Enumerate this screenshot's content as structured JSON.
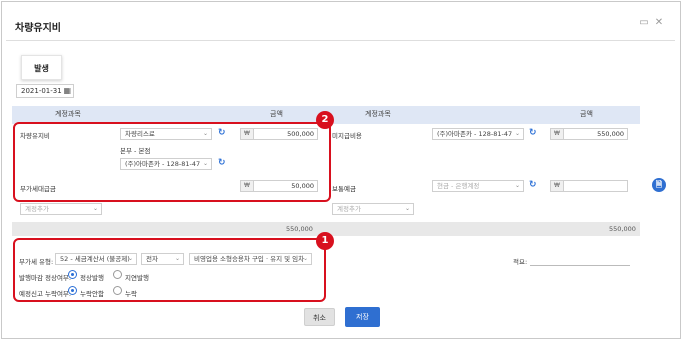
{
  "window": {
    "title": "차량유지비"
  },
  "tabs": [
    {
      "label": "발생"
    }
  ],
  "date": {
    "value": "2021-01-31"
  },
  "table_header": {
    "col1": "계정과목",
    "col2": "금액",
    "col3": "계정과목",
    "col4": "금액"
  },
  "left": {
    "row1_label": "차량유지비",
    "row1_select": "차량리스료",
    "row1_amount_currency": "₩",
    "row1_amount": "500,000",
    "branch_label": "본부 - 본점",
    "vendor_select": "(주)아마존카 - 128-81-47",
    "row2_label": "부가세대급금",
    "row2_amount_currency": "₩",
    "row2_amount": "50,000",
    "add_account_placeholder": "계정추가",
    "total": "550,000"
  },
  "right": {
    "row1_label": "미지급비용",
    "vendor_select": "(주)아마존카 - 128-81-47",
    "row1_amount_currency": "₩",
    "row1_amount": "550,000",
    "row2_label": "보통예금",
    "bank_placeholder": "현금 - 은행계정",
    "row2_amount_currency": "₩",
    "row2_amount": "",
    "add_account_placeholder": "계정추가",
    "total": "550,000"
  },
  "vat": {
    "type_label": "부가세 유형:",
    "type_select": "52 - 세금계산서 (불공제)",
    "issue_select": "전자",
    "reason_select": "비영업용 소형승용차 구입 · 유지 및 임차",
    "issue_normal_label": "발행마감 정상여부:",
    "issue_normal_on": "정상발행",
    "issue_normal_off": "지연발행",
    "report_label": "예정신고 누락여부:",
    "report_on": "누락안함",
    "report_off": "누락",
    "memo_label": "적요:",
    "memo_value": ""
  },
  "buttons": {
    "cancel": "취소",
    "save": "저장"
  },
  "badges": {
    "one": "1",
    "two": "2"
  },
  "colors": {
    "accent": "#2f6fd1",
    "highlight": "#d8101e",
    "header_bg": "#dfe7f5"
  }
}
